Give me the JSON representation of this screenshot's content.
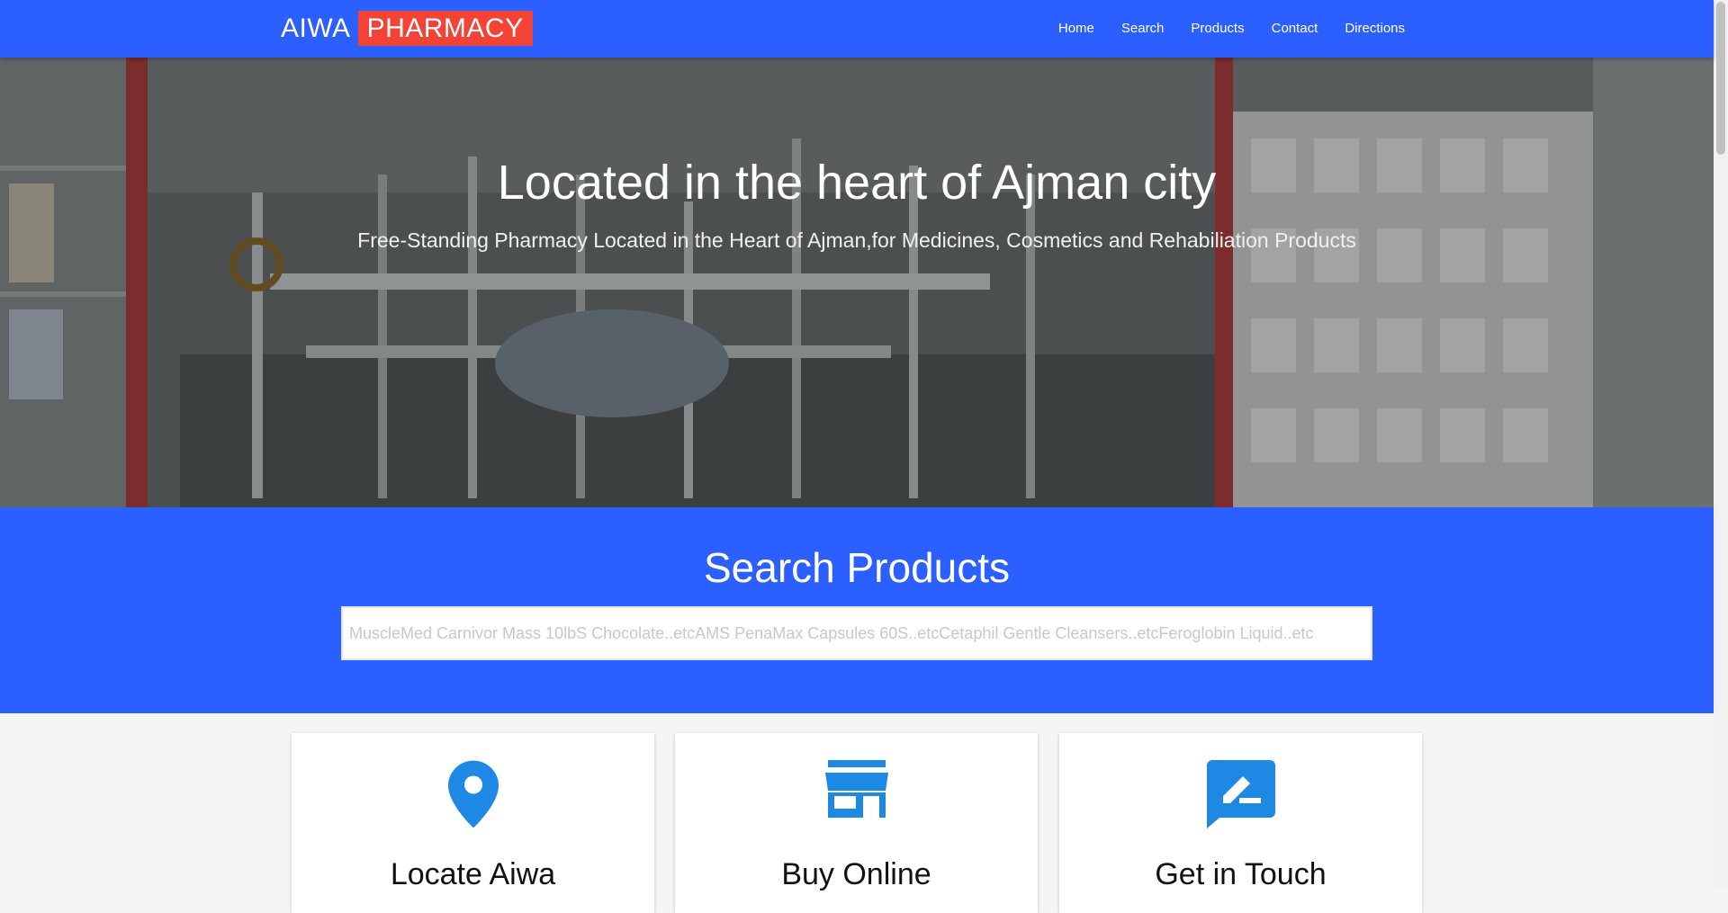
{
  "navbar": {
    "brand_first": "AIWA",
    "brand_second": "PHARMACY",
    "links": [
      "Home",
      "Search",
      "Products",
      "Contact",
      "Directions"
    ]
  },
  "hero": {
    "title": "Located in the heart of Ajman city",
    "subtitle": "Free-Standing Pharmacy Located in the Heart of Ajman,for Medicines, Cosmetics and Rehabiliation Products"
  },
  "search": {
    "title": "Search Products",
    "placeholder": "MuscleMed Carnivor Mass 10lbS Chocolate..etcAMS PenaMax Capsules 60S..etcCetaphil Gentle Cleansers..etcFeroglobin Liquid..etc"
  },
  "cards": [
    {
      "title": "Locate Aiwa",
      "icon": "map-pin-icon"
    },
    {
      "title": "Buy Online",
      "icon": "store-icon"
    },
    {
      "title": "Get in Touch",
      "icon": "message-edit-icon"
    }
  ],
  "colors": {
    "primary_blue": "#2c5fff",
    "brand_red": "#f44336",
    "icon_blue": "#1e88e5"
  }
}
